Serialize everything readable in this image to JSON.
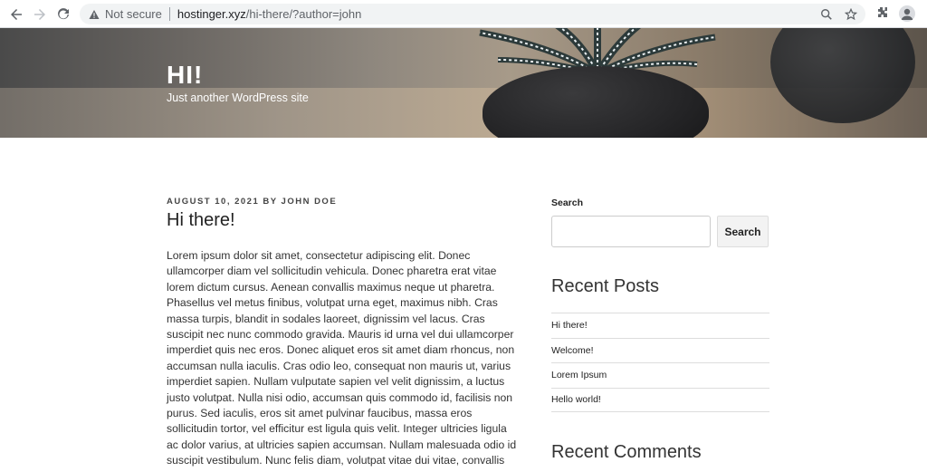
{
  "browser": {
    "not_secure": "Not secure",
    "url_host": "hostinger.xyz",
    "url_path": "/hi-there/?author=john",
    "icons": [
      "back-icon",
      "forward-icon",
      "reload-icon",
      "warning-icon",
      "zoom-icon",
      "star-icon",
      "extensions-icon",
      "profile-icon"
    ]
  },
  "header": {
    "site_title": "HI!",
    "site_description": "Just another WordPress site"
  },
  "post": {
    "meta": "AUGUST 10, 2021 BY JOHN DOE",
    "title": "Hi there!",
    "body": "Lorem ipsum dolor sit amet, consectetur adipiscing elit. Donec ullamcorper diam vel sollicitudin vehicula. Donec pharetra erat vitae lorem dictum cursus. Aenean convallis maximus neque ut pharetra. Phasellus vel metus finibus, volutpat urna eget, maximus nibh. Cras massa turpis, blandit in sodales laoreet, dignissim vel lacus. Cras suscipit nec nunc commodo gravida. Mauris id urna vel dui ullamcorper imperdiet quis nec eros. Donec aliquet eros sit amet diam rhoncus, non accumsan nulla iaculis. Cras odio leo, consequat non mauris ut, varius imperdiet sapien. Nullam vulputate sapien vel velit dignissim, a luctus justo volutpat. Nulla nisi odio, accumsan quis commodo id, facilisis non purus. Sed iaculis, eros sit amet pulvinar faucibus, massa eros sollicitudin tortor, vel efficitur est ligula quis velit. Integer ultricies ligula ac dolor varius, at ultricies sapien accumsan. Nullam malesuada odio id suscipit vestibulum. Nunc felis diam, volutpat vitae dui vitae, convallis"
  },
  "sidebar": {
    "search_label": "Search",
    "search_button": "Search",
    "search_value": "",
    "recent_posts_title": "Recent Posts",
    "recent_posts": [
      "Hi there!",
      "Welcome!",
      "Lorem Ipsum",
      "Hello world!"
    ],
    "recent_comments_title": "Recent Comments"
  }
}
